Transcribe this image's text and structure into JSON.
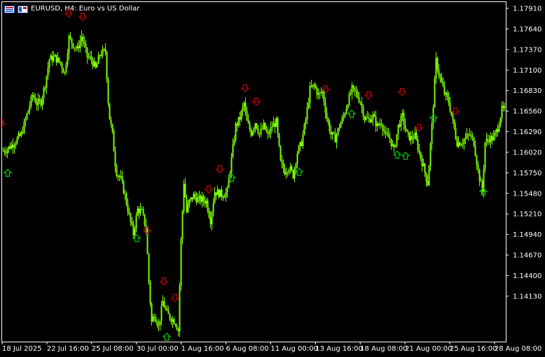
{
  "window": {
    "title": "EURUSD, H4:  Euro vs US Dollar",
    "symbol_icon": "market-watch-icon",
    "pin_icon": "window-pin-icon"
  },
  "colors": {
    "background": "#000000",
    "candle": "#7CFC00",
    "axis": "#FFFFFF",
    "axis_text": "#FFFFFF",
    "arrow_up": "#00C000",
    "arrow_down": "#C00000"
  },
  "chart_data": {
    "type": "candlestick",
    "symbol": "EURUSD",
    "timeframe": "H4",
    "y_axis_labels": [
      "1.17910",
      "1.17640",
      "1.17370",
      "1.17100",
      "1.16830",
      "1.16560",
      "1.16290",
      "1.16020",
      "1.15750",
      "1.15480",
      "1.15210",
      "1.14940",
      "1.14670",
      "1.14400",
      "1.14130"
    ],
    "x_axis_labels": [
      "18 Jul 2025",
      "22 Jul 16:00",
      "25 Jul 08:00",
      "30 Jul 00:00",
      "1 Aug 16:00",
      "6 Aug 08:00",
      "11 Aug 00:00",
      "13 Aug 16:00",
      "18 Aug 08:00",
      "21 Aug 00:00",
      "25 Aug 16:00",
      "28 Aug 08:00"
    ],
    "ylim": [
      1.1398,
      1.1805
    ],
    "close_path": [
      [
        0,
        1.1637
      ],
      [
        4,
        1.163
      ],
      [
        10,
        1.1632
      ],
      [
        20,
        1.164
      ],
      [
        30,
        1.165
      ],
      [
        40,
        1.168
      ],
      [
        46,
        1.1698
      ],
      [
        52,
        1.1688
      ],
      [
        58,
        1.169
      ],
      [
        64,
        1.1712
      ],
      [
        70,
        1.1742
      ],
      [
        78,
        1.1744
      ],
      [
        86,
        1.1737
      ],
      [
        92,
        1.1725
      ],
      [
        98,
        1.1768
      ],
      [
        104,
        1.176
      ],
      [
        110,
        1.1754
      ],
      [
        116,
        1.177
      ],
      [
        124,
        1.1745
      ],
      [
        130,
        1.1742
      ],
      [
        136,
        1.173
      ],
      [
        142,
        1.1748
      ],
      [
        150,
        1.1752
      ],
      [
        155,
        1.1675
      ],
      [
        160,
        1.165
      ],
      [
        165,
        1.1605
      ],
      [
        172,
        1.1595
      ],
      [
        178,
        1.1575
      ],
      [
        184,
        1.155
      ],
      [
        190,
        1.1528
      ],
      [
        196,
        1.1558
      ],
      [
        202,
        1.1555
      ],
      [
        208,
        1.1535
      ],
      [
        212,
        1.147
      ],
      [
        216,
        1.142
      ],
      [
        220,
        1.143
      ],
      [
        226,
        1.1415
      ],
      [
        232,
        1.1445
      ],
      [
        238,
        1.143
      ],
      [
        244,
        1.1425
      ],
      [
        250,
        1.142
      ],
      [
        254,
        1.141
      ],
      [
        258,
        1.152
      ],
      [
        262,
        1.1592
      ],
      [
        266,
        1.1555
      ],
      [
        270,
        1.1568
      ],
      [
        276,
        1.1575
      ],
      [
        282,
        1.157
      ],
      [
        288,
        1.157
      ],
      [
        294,
        1.1568
      ],
      [
        300,
        1.1545
      ],
      [
        306,
        1.158
      ],
      [
        312,
        1.1578
      ],
      [
        318,
        1.1576
      ],
      [
        324,
        1.158
      ],
      [
        330,
        1.162
      ],
      [
        336,
        1.166
      ],
      [
        342,
        1.167
      ],
      [
        348,
        1.1688
      ],
      [
        352,
        1.1665
      ],
      [
        358,
        1.1652
      ],
      [
        364,
        1.1665
      ],
      [
        370,
        1.165
      ],
      [
        376,
        1.166
      ],
      [
        382,
        1.1648
      ],
      [
        388,
        1.166
      ],
      [
        394,
        1.1665
      ],
      [
        400,
        1.1615
      ],
      [
        406,
        1.1605
      ],
      [
        412,
        1.161
      ],
      [
        418,
        1.16
      ],
      [
        424,
        1.1628
      ],
      [
        430,
        1.164
      ],
      [
        436,
        1.1668
      ],
      [
        442,
        1.1705
      ],
      [
        448,
        1.171
      ],
      [
        454,
        1.1698
      ],
      [
        460,
        1.1702
      ],
      [
        466,
        1.167
      ],
      [
        472,
        1.165
      ],
      [
        478,
        1.1645
      ],
      [
        484,
        1.166
      ],
      [
        490,
        1.1672
      ],
      [
        496,
        1.169
      ],
      [
        502,
        1.1705
      ],
      [
        508,
        1.17
      ],
      [
        514,
        1.169
      ],
      [
        520,
        1.167
      ],
      [
        526,
        1.1668
      ],
      [
        532,
        1.1672
      ],
      [
        538,
        1.166
      ],
      [
        544,
        1.1665
      ],
      [
        550,
        1.1648
      ],
      [
        556,
        1.1645
      ],
      [
        562,
        1.163
      ],
      [
        568,
        1.166
      ],
      [
        574,
        1.1672
      ],
      [
        580,
        1.165
      ],
      [
        586,
        1.1645
      ],
      [
        592,
        1.1648
      ],
      [
        598,
        1.1628
      ],
      [
        604,
        1.161
      ],
      [
        610,
        1.159
      ],
      [
        616,
        1.166
      ],
      [
        622,
        1.174
      ],
      [
        628,
        1.1718
      ],
      [
        634,
        1.17
      ],
      [
        640,
        1.169
      ],
      [
        646,
        1.1665
      ],
      [
        652,
        1.164
      ],
      [
        658,
        1.164
      ],
      [
        664,
        1.1645
      ],
      [
        670,
        1.165
      ],
      [
        676,
        1.164
      ],
      [
        682,
        1.1605
      ],
      [
        688,
        1.158
      ],
      [
        692,
        1.164
      ],
      [
        698,
        1.1645
      ],
      [
        704,
        1.1645
      ],
      [
        710,
        1.1658
      ],
      [
        716,
        1.168
      ],
      [
        722,
        1.168
      ]
    ],
    "signals": [
      {
        "x": 2,
        "dir": "down"
      },
      {
        "x": 11,
        "dir": "up"
      },
      {
        "x": 98,
        "dir": "down"
      },
      {
        "x": 118,
        "dir": "down"
      },
      {
        "x": 195,
        "dir": "up"
      },
      {
        "x": 210,
        "dir": "down"
      },
      {
        "x": 234,
        "dir": "down"
      },
      {
        "x": 238,
        "dir": "up"
      },
      {
        "x": 250,
        "dir": "down"
      },
      {
        "x": 298,
        "dir": "down"
      },
      {
        "x": 314,
        "dir": "down"
      },
      {
        "x": 331,
        "dir": "up"
      },
      {
        "x": 350,
        "dir": "down"
      },
      {
        "x": 366,
        "dir": "down"
      },
      {
        "x": 427,
        "dir": "up"
      },
      {
        "x": 465,
        "dir": "down"
      },
      {
        "x": 502,
        "dir": "up"
      },
      {
        "x": 526,
        "dir": "down"
      },
      {
        "x": 567,
        "dir": "up"
      },
      {
        "x": 574,
        "dir": "down"
      },
      {
        "x": 579,
        "dir": "up"
      },
      {
        "x": 598,
        "dir": "down"
      },
      {
        "x": 619,
        "dir": "up"
      },
      {
        "x": 650,
        "dir": "down"
      },
      {
        "x": 690,
        "dir": "up"
      }
    ]
  }
}
